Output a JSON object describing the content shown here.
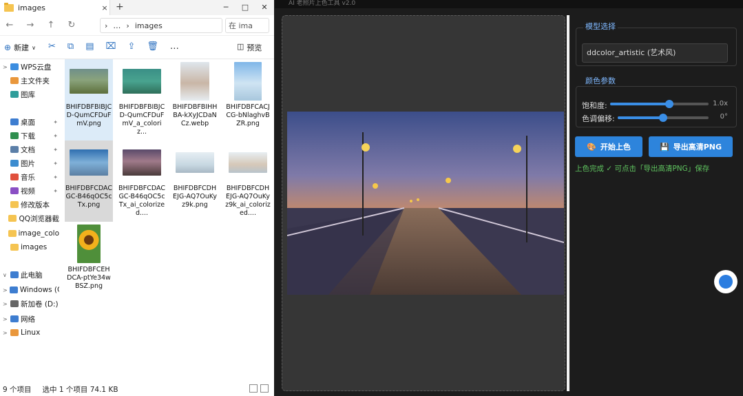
{
  "explorer": {
    "tab_title": "images",
    "close_glyph": "×",
    "add_tab": "+",
    "window_controls": [
      "─",
      "□",
      "✕"
    ],
    "nav": {
      "back": "←",
      "forward": "→",
      "up": "↑",
      "refresh": "↻"
    },
    "address": {
      "more": "…",
      "folder": "images"
    },
    "search_placeholder": "在 ima",
    "toolbar": {
      "new_label": "新建",
      "preview_label": "预览",
      "more": "…"
    },
    "sidebar": [
      {
        "label": "WPS云盘",
        "arrow": ">",
        "color": "#3b8de0"
      },
      {
        "label": "主文件夹",
        "arrow": "",
        "color": "#e9973c"
      },
      {
        "label": "图库",
        "arrow": "",
        "color": "#2f9d9a"
      },
      {
        "label": "桌面",
        "arrow": "",
        "color": "#3d7dd0",
        "pin": "✦"
      },
      {
        "label": "下载",
        "arrow": "",
        "color": "#2f8f4f",
        "pin": "✦"
      },
      {
        "label": "文档",
        "arrow": "",
        "color": "#5b7fa8",
        "pin": "✦"
      },
      {
        "label": "图片",
        "arrow": "",
        "color": "#3c8ccf",
        "pin": "✦"
      },
      {
        "label": "音乐",
        "arrow": "",
        "color": "#e0503c",
        "pin": "✦"
      },
      {
        "label": "视频",
        "arrow": "",
        "color": "#8a4fc4",
        "pin": "✦"
      },
      {
        "label": "修改版本",
        "arrow": "",
        "color": "#f5c451"
      },
      {
        "label": "QQ浏览器截",
        "arrow": "",
        "color": "#f5c451"
      },
      {
        "label": "image_colo",
        "arrow": "",
        "color": "#f5c451"
      },
      {
        "label": "images",
        "arrow": "",
        "color": "#f5c451"
      },
      {
        "label": "此电脑",
        "arrow": "∨",
        "color": "#3d7dd0"
      },
      {
        "label": "Windows (C",
        "arrow": ">",
        "color": "#3d7dd0"
      },
      {
        "label": "新加卷 (D:)",
        "arrow": ">",
        "color": "#666666"
      },
      {
        "label": "网络",
        "arrow": ">",
        "color": "#3d7dd0"
      },
      {
        "label": "Linux",
        "arrow": ">",
        "color": "#e9973c"
      }
    ],
    "files": [
      "BHIFDBFBIBJCD-QumCFDuFmV.png",
      "BHIFDBFBIBJCD-QumCFDuFmV_a_coloriz...",
      "BHIFDBFBIHHBA-kXyJCDaNCz.webp",
      "BHIFDBFCACJCG-bNlaghvBZR.png",
      "BHIFDBFCDACGC-B46qOC5cTx.png",
      "BHIFDBFCDACGC-B46qOC5cTx_ai_colorized....",
      "BHIFDBFCDHEJG-AQ7OuKyz9k.png",
      "BHIFDBFCDHEJG-AQ7OuKyz9k_ai_colorized....",
      "BHIFDBFCEHDCA-ptYe34wBSZ.png"
    ],
    "status": {
      "count": "9 个项目",
      "selected": "选中 1 个项目  74.1 KB"
    }
  },
  "app": {
    "title": "AI 老照片上色工具 v2.0",
    "model_group_title": "模型选择",
    "model_value": "ddcolor_artistic (艺术风)",
    "params_group_title": "颜色参数",
    "saturation_label": "饱和度:",
    "saturation_value": "1.0x",
    "saturation_level": 0.6,
    "hue_label": "色调偏移:",
    "hue_value": "0°",
    "hue_level": 0.5,
    "start_button": "开始上色",
    "export_button": "导出高清PNG",
    "status_message": "上色完成 ✓  可点击「导出高清PNG」保存"
  }
}
